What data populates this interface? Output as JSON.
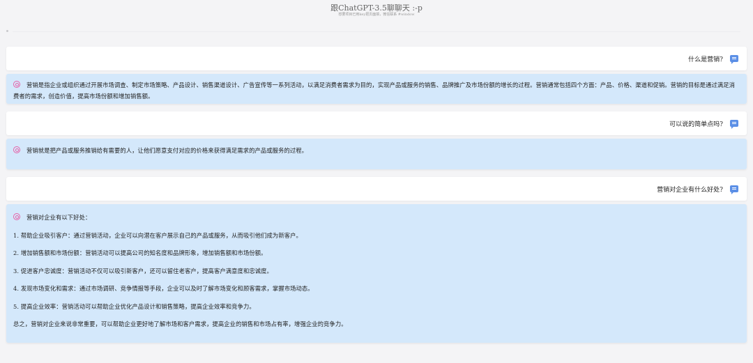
{
  "header": {
    "title": "跟ChatGPT-3.5聊聊天 :-p",
    "subtitle": "想要项目已用key把页面搞，微信联系 #window"
  },
  "messages": [
    {
      "question": "什么是营销?",
      "answer": "营销是指企业或组织通过开展市场调查、制定市场策略、产品设计、销售渠道设计、广告宣传等一系列活动，以满足消费者需求为目的，实现产品或服务的销售、品牌推广及市场份额的增长的过程。营销通常包括四个方面：产品、价格、渠道和促销。营销的目标是通过满足消费者的需求，创造价值，提高市场份额和增加销售额。"
    },
    {
      "question": "可以说的简单点吗?",
      "answer": "营销就是把产品或服务推销给有需要的人，让他们愿意支付对应的价格来获得满足需求的产品或服务的过程。"
    },
    {
      "question": "营销对企业有什么好处?",
      "answer_lines": [
        "营销对企业有以下好处：",
        "1. 帮助企业吸引客户：通过营销活动，企业可以向潜在客户展示自己的产品或服务，从而吸引他们成为新客户。",
        "2. 增加销售额和市场份额：营销活动可以提高公司的知名度和品牌形象，增加销售额和市场份额。",
        "3. 促进客户忠诚度：营销活动不仅可以吸引新客户，还可以留住老客户，提高客户满意度和忠诚度。",
        "4. 发现市场变化和需求：通过市场调研、竞争情报等手段，企业可以及时了解市场变化和顾客需求，掌握市场动态。",
        "5. 提高企业效率：营销活动可以帮助企业优化产品设计和销售策略，提高企业效率和竞争力。",
        "总之，营销对企业来说非常重要，可以帮助企业更好地了解市场和客户需求，提高企业的销售和市场占有率，增强企业的竞争力。"
      ]
    }
  ],
  "icons": {
    "user": "message-icon",
    "bot": "openai-icon"
  },
  "colors": {
    "background": "#f4f4f6",
    "question_bg": "#ffffff",
    "answer_bg": "#d4e8fb",
    "user_icon": "#5b8fe6",
    "bot_icon": "#e65fa6"
  }
}
